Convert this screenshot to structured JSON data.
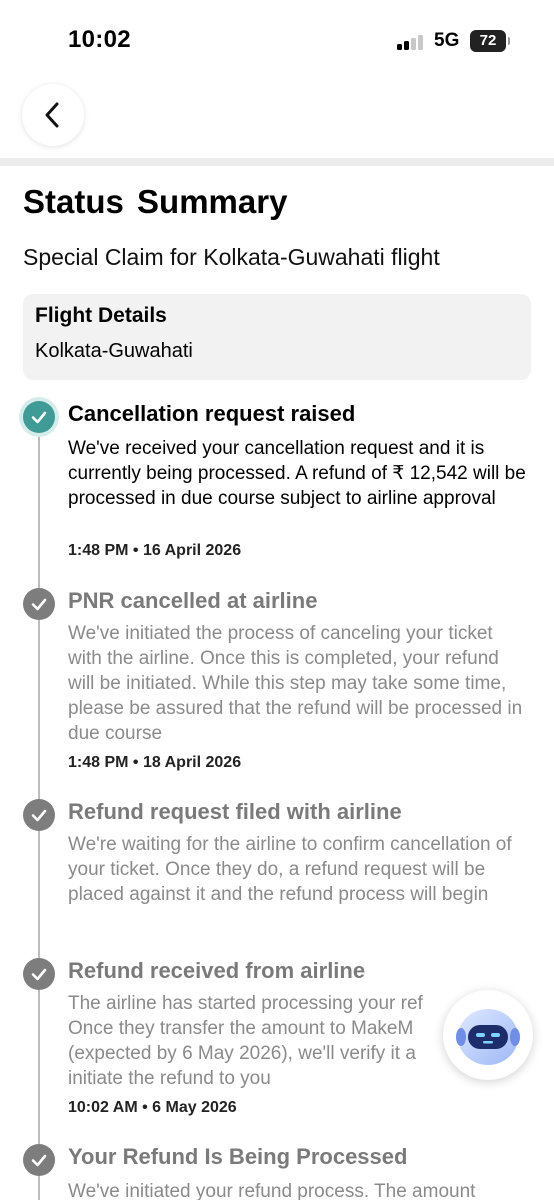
{
  "status_bar": {
    "time": "10:02",
    "network": "5G",
    "battery": "72"
  },
  "header": {
    "back_icon": "chevron-left-icon"
  },
  "page": {
    "title": "Status  Summary",
    "subtitle": "Special Claim for Kolkata-Guwahati flight"
  },
  "flight_details": {
    "label": "Flight Details",
    "route": "Kolkata-Guwahati"
  },
  "colors": {
    "completed": "#3e9b96",
    "pending": "#7d7d7d",
    "line": "#bdbdbd"
  },
  "timeline": [
    {
      "title": "Cancellation request raised",
      "description": "We've received your cancellation request and it is currently being processed. A refund of ₹ 12,542 will be processed in due course subject to airline approval",
      "timestamp": "1:48 PM • 16 April 2026",
      "state": "completed"
    },
    {
      "title": "PNR cancelled at airline",
      "description": "We've initiated the process of canceling your ticket with the airline. Once this is completed, your refund will be initiated. While this step may take some time, please be assured that the refund will be processed in due course",
      "timestamp": "1:48 PM • 18 April 2026",
      "state": "pending"
    },
    {
      "title": "Refund request filed with airline",
      "description": "We're waiting for the airline to confirm cancellation of your ticket. Once they do, a refund request will be placed against it and the refund process will begin",
      "timestamp": "",
      "state": "pending"
    },
    {
      "title": "Refund received from airline",
      "description": "The airline has started processing your ref Once they transfer the amount to MakeM (expected by 6 May 2026), we'll verify it a initiate the refund to you",
      "timestamp": "10:02 AM • 6 May 2026",
      "state": "pending"
    },
    {
      "title": "Your Refund Is Being Processed",
      "description": "We've initiated your refund process. The amount",
      "timestamp": "",
      "state": "pending"
    }
  ],
  "chatbot": {
    "icon": "chatbot-robot-icon"
  }
}
